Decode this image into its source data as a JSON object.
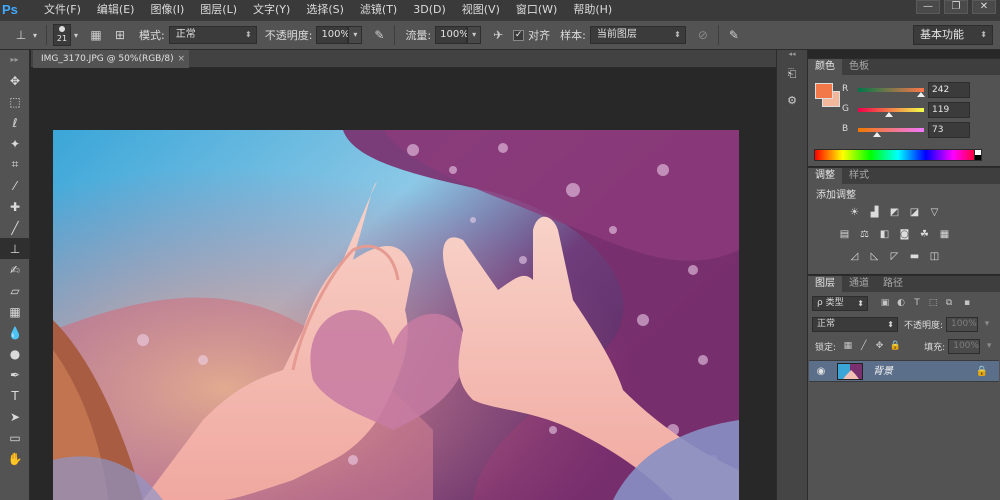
{
  "app": {
    "logo": "Ps"
  },
  "menu": [
    "文件(F)",
    "编辑(E)",
    "图像(I)",
    "图层(L)",
    "文字(Y)",
    "选择(S)",
    "滤镜(T)",
    "3D(D)",
    "视图(V)",
    "窗口(W)",
    "帮助(H)"
  ],
  "window_controls": {
    "minimize": "—",
    "restore": "❐",
    "close": "✕"
  },
  "options": {
    "brush_size": "21",
    "mode_label": "模式:",
    "mode_value": "正常",
    "opacity_label": "不透明度:",
    "opacity_value": "100%",
    "flow_label": "流量:",
    "flow_value": "100%",
    "align_label": "对齐",
    "align_checked": "✓",
    "sample_label": "样本:",
    "sample_value": "当前图层"
  },
  "workspace": "基本功能",
  "document": {
    "tab_title": "IMG_3170.JPG @ 50%(RGB/8)",
    "close": "×"
  },
  "tools": [
    "move-tool",
    "marquee-tool",
    "lasso-tool",
    "magic-wand-tool",
    "crop-tool",
    "eyedropper-tool",
    "spot-healing-tool",
    "brush-tool",
    "clone-stamp-tool",
    "history-brush-tool",
    "eraser-tool",
    "gradient-tool",
    "blur-tool",
    "dodge-tool",
    "pen-tool",
    "type-tool",
    "path-selection-tool",
    "shape-tool",
    "hand-tool"
  ],
  "tool_glyphs": [
    "✥",
    "⬚",
    "ℓ",
    "✦",
    "⌗",
    "⁄",
    "✚",
    "╱",
    "⊥",
    "✍",
    "▱",
    "▦",
    "💧",
    "●",
    "✒",
    "T",
    "➤",
    "▭",
    "✋"
  ],
  "color_panel": {
    "tabs": [
      "颜色",
      "色板"
    ],
    "foreground": "#f27749",
    "background": "#f3b79b",
    "channels": [
      {
        "label": "R",
        "value": "242"
      },
      {
        "label": "G",
        "value": "119"
      },
      {
        "label": "B",
        "value": "73"
      }
    ]
  },
  "adjustments_panel": {
    "tabs": [
      "调整",
      "样式"
    ],
    "title": "添加调整"
  },
  "layers_panel": {
    "tabs": [
      "图层",
      "通道",
      "路径"
    ],
    "filter_label": "ρ 类型",
    "blend_mode": "正常",
    "opacity_label": "不透明度:",
    "opacity_value": "100%",
    "lock_label": "锁定:",
    "fill_label": "填充:",
    "fill_value": "100%",
    "layer_name": "背景"
  }
}
